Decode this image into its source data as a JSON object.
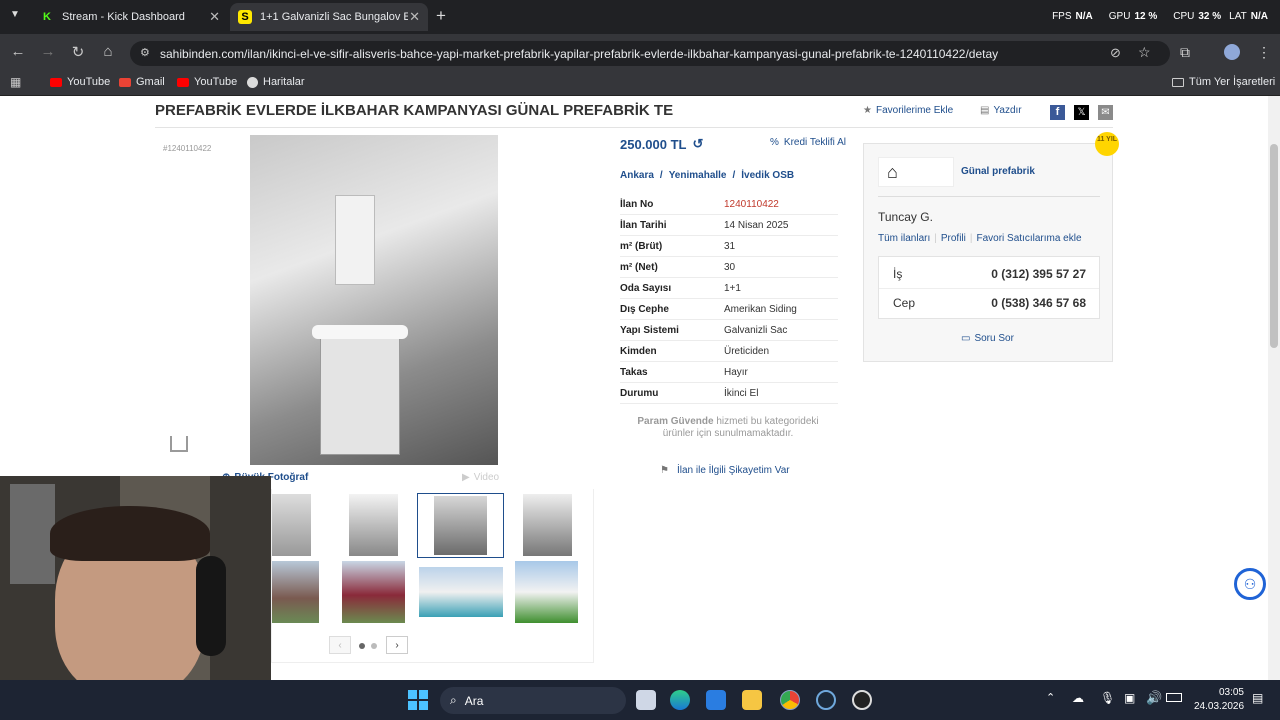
{
  "browser": {
    "tabs": [
      {
        "title": "Stream - Kick Dashboard",
        "fav_letter": "K",
        "fav_color": "#53fc18"
      },
      {
        "title": "1+1 Galvanizli Sac Bungalov Ev",
        "fav_letter": "S",
        "fav_color": "#ffe800"
      }
    ],
    "url": "sahibinden.com/ilan/ikinci-el-ve-sifir-alisveris-bahce-yapi-market-prefabrik-yapilar-prefabrik-evlerde-ilkbahar-kampanyasi-gunal-prefabrik-te-1240110422/detay",
    "bookmarks": [
      "YouTube",
      "Gmail",
      "YouTube",
      "Haritalar"
    ],
    "all_bookmarks": "Tüm Yer İşaretleri"
  },
  "overlay_stats": {
    "fps_label": "FPS",
    "fps_value": "N/A",
    "gpu_label": "GPU",
    "gpu_value": "12 %",
    "cpu_label": "CPU",
    "cpu_value": "32 %",
    "lat_label": "LAT",
    "lat_value": "N/A"
  },
  "listing": {
    "title": "PREFABRİK EVLERDE İLKBAHAR KAMPANYASI GÜNAL PREFABRİK TE",
    "actions": {
      "favorite": "Favorilerime Ekle",
      "print": "Yazdır"
    },
    "photo_id": "#1240110422",
    "price": "250.000 TL",
    "credit_offer": "Kredi Teklifi Al",
    "location": [
      "Ankara",
      "Yenimahalle",
      "İvedik OSB"
    ],
    "location_sep": "/",
    "details": [
      {
        "key": "İlan No",
        "value": "1240110422"
      },
      {
        "key": "İlan Tarihi",
        "value": "14 Nisan 2025"
      },
      {
        "key": "m² (Brüt)",
        "value": "31"
      },
      {
        "key": "m² (Net)",
        "value": "30"
      },
      {
        "key": "Oda Sayısı",
        "value": "1+1"
      },
      {
        "key": "Dış Cephe",
        "value": "Amerikan Siding"
      },
      {
        "key": "Yapı Sistemi",
        "value": "Galvanizli Sac"
      },
      {
        "key": "Kimden",
        "value": "Üreticiden"
      },
      {
        "key": "Takas",
        "value": "Hayır"
      },
      {
        "key": "Durumu",
        "value": "İkinci El"
      }
    ],
    "param_guvende_bold": "Param Güvende",
    "param_guvende_rest": " hizmeti bu kategorideki ürünler için sunulmamaktadır.",
    "complaint": "İlan ile İlgili Şikayetim Var",
    "photo_tabs": {
      "photo": "Büyük Fotoğraf",
      "video": "Video"
    },
    "pager_dots": 2
  },
  "seller": {
    "badge": "11 YIL",
    "store_name": "Günal prefabrik",
    "name": "Tuncay G.",
    "links": [
      "Tüm ilanları",
      "Profili",
      "Favori Satıcılarıma ekle"
    ],
    "phones": [
      {
        "label": "İş",
        "number": "0 (312) 395 57 27"
      },
      {
        "label": "Cep",
        "number": "0 (538) 346 57 68"
      }
    ],
    "ask": "Soru Sor"
  },
  "taskbar": {
    "search": "Ara",
    "time": "03:05",
    "date": "24.03.2026"
  }
}
